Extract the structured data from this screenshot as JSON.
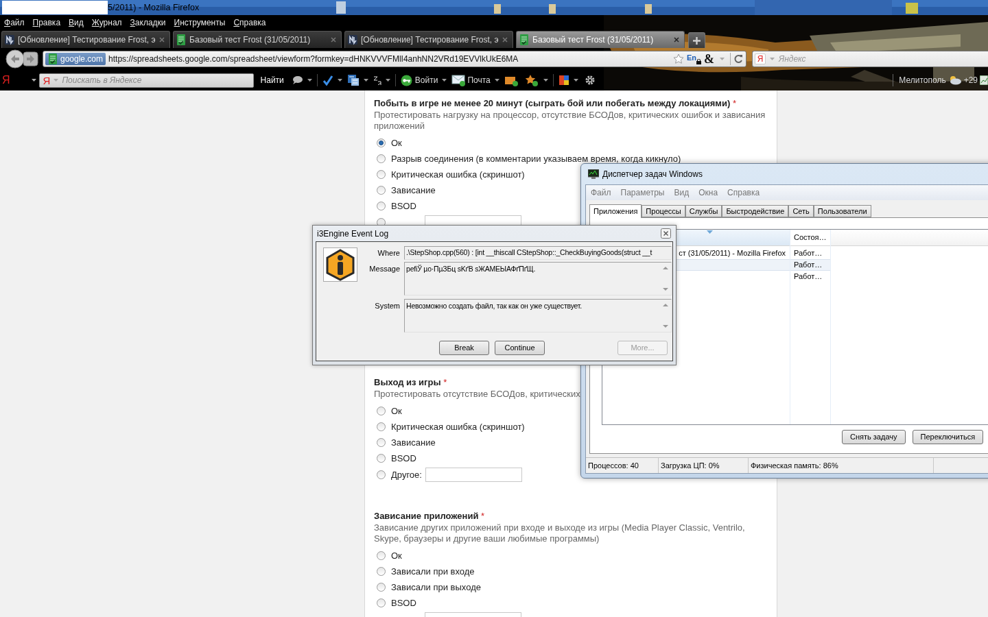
{
  "window": {
    "title": "5/2011) - Mozilla Firefox"
  },
  "menu": [
    "Файл",
    "Правка",
    "Вид",
    "Журнал",
    "Закладки",
    "Инструменты",
    "Справка"
  ],
  "tabs": [
    {
      "label": "[Обновление] Тестирование Frost, э",
      "kind": "forum",
      "selected": false
    },
    {
      "label": "Базовый тест Frost (31/05/2011)",
      "kind": "sheet",
      "selected": false
    },
    {
      "label": "[Обновление] Тестирование Frost, э",
      "kind": "forum",
      "selected": false
    },
    {
      "label": "Базовый тест Frost (31/05/2011)",
      "kind": "sheet",
      "selected": true
    }
  ],
  "address_bar": {
    "site": "google.com",
    "url": "https://spreadsheets.google.com/spreadsheet/viewform?formkey=dHNKVVVFMlI4anhNN2VRd19EVVlkUkE6MA",
    "lang": "En",
    "symbol": "&"
  },
  "search_bar": {
    "logo": "Я",
    "placeholder": "Яндекс"
  },
  "yandex_bar": {
    "logo": "Я",
    "search_logo": "Я",
    "search_placeholder": "Поискать в Яндексе",
    "find": "Найти",
    "login": "Войти",
    "mail": "Почта",
    "city": "Мелитополь",
    "temperature": "+29"
  },
  "form": {
    "questions": [
      {
        "title": "Побыть в игре не менее 20 минут (сыграть бой или побегать между локациями)",
        "required_mark": "*",
        "description": "Протестировать нагрузку на процессор, отсутствие БСОДов, критических ошибок и зависания приложений",
        "options": [
          {
            "label": "Ок",
            "selected": true
          },
          {
            "label": "Разрыв соединения (в комментарии указываем время, когда кикнуло)",
            "selected": false
          },
          {
            "label": "Критическая ошибка (скриншот)",
            "selected": false
          },
          {
            "label": "Зависание",
            "selected": false
          },
          {
            "label": "BSOD",
            "selected": false
          },
          {
            "kind": "other",
            "selected": false
          }
        ]
      },
      {
        "title": "Выход из игры",
        "required_mark": "*",
        "description": "Протестировать отсутствие БСОДов, критических",
        "options": [
          {
            "label": "Ок",
            "selected": false
          },
          {
            "label": "Критическая ошибка (скриншот)",
            "selected": false
          },
          {
            "label": "Зависание",
            "selected": false
          },
          {
            "label": "BSOD",
            "selected": false
          },
          {
            "label": "Другое:",
            "kind": "other",
            "selected": false
          }
        ]
      },
      {
        "title": "Зависание приложений",
        "required_mark": "*",
        "description": "Зависание других приложений при входе и выходе из игры (Media Player Classic, Ventrilo, Skype, браузеры и другие ваши любимые программы)",
        "options": [
          {
            "label": "Ок",
            "selected": false
          },
          {
            "label": "Зависали при входе",
            "selected": false
          },
          {
            "label": "Зависали при выходе",
            "selected": false
          },
          {
            "label": "BSOD",
            "selected": false
          },
          {
            "kind": "other"
          }
        ]
      }
    ]
  },
  "task_manager": {
    "title": "Диспетчер задач Windows",
    "menu": [
      "Файл",
      "Параметры",
      "Вид",
      "Окна",
      "Справка"
    ],
    "tabs": [
      {
        "label": "Приложения",
        "selected": true
      },
      {
        "label": "Процессы",
        "selected": false
      },
      {
        "label": "Службы",
        "selected": false
      },
      {
        "label": "Быстродействие",
        "selected": false
      },
      {
        "label": "Сеть",
        "selected": false
      },
      {
        "label": "Пользователи",
        "selected": false
      }
    ],
    "status_header": "Состоя…",
    "rows": [
      {
        "task": "ст (31/05/2011) - Mozilla Firefox",
        "status": "Работ…",
        "selected": false
      },
      {
        "status": "Работ…",
        "selected": true
      },
      {
        "status": "Работ…",
        "selected": false
      }
    ],
    "buttons": [
      "Снять задачу",
      "Переключиться"
    ],
    "status_bar": [
      "Процессов: 40",
      "Загрузка ЦП: 0%",
      "Физическая память: 86%"
    ]
  },
  "event_log": {
    "title": "i3Engine Event Log",
    "fields": [
      {
        "label": "Where",
        "value": ".\\StepShop.cpp(560) : [int __thiscall CStepShop::_CheckBuyingGoods(struct __t",
        "kind": "line"
      },
      {
        "label": "Message",
        "value": "pefiЎ µо·ПµЗБц sKґВ sЖАМЕЫАФґПґЩ.",
        "kind": "box"
      },
      {
        "label": "System",
        "value": "Невозможно создать файл, так как он уже существует.",
        "kind": "box"
      }
    ],
    "buttons": [
      {
        "label": "Break",
        "disabled": false
      },
      {
        "label": "Continue",
        "disabled": false
      },
      {
        "label": "More...",
        "disabled": true
      }
    ]
  }
}
